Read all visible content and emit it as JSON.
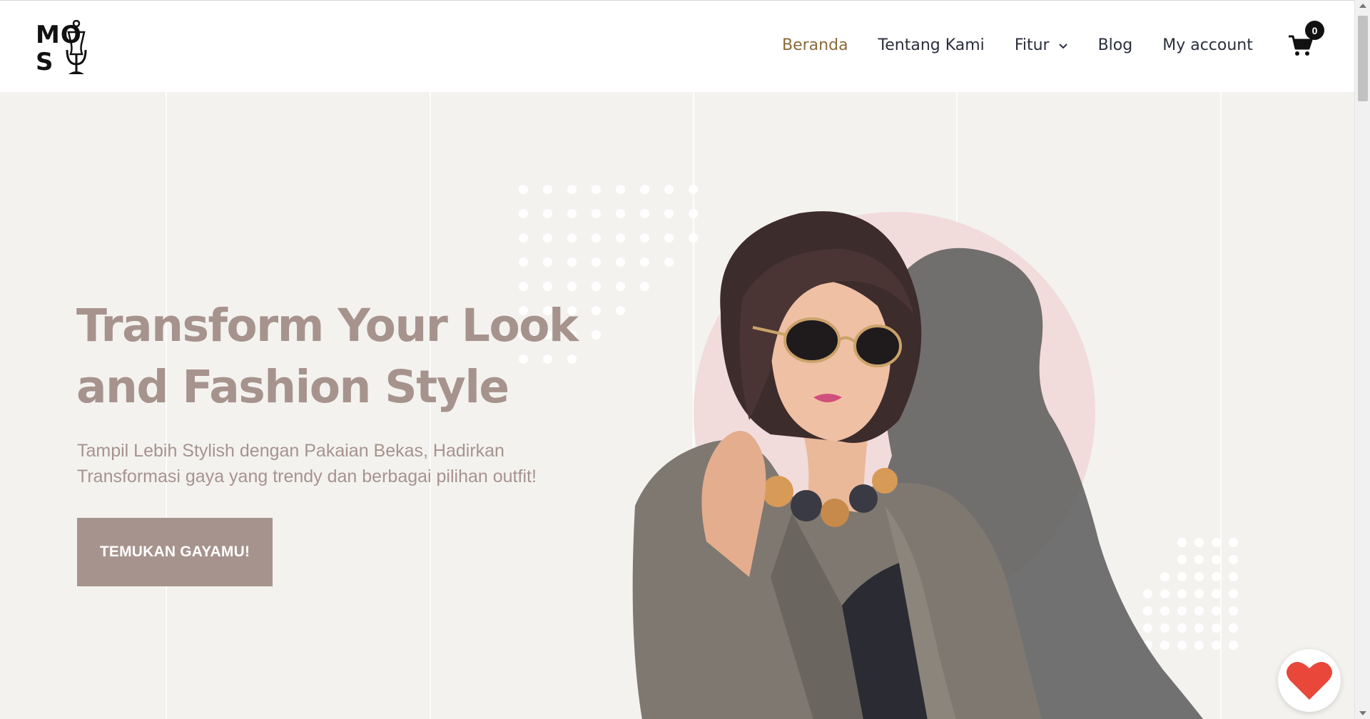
{
  "logo": {
    "left": "MO",
    "right": "S"
  },
  "nav": {
    "items": [
      {
        "label": "Beranda",
        "active": true
      },
      {
        "label": "Tentang Kami",
        "active": false
      },
      {
        "label": "Fitur",
        "active": false,
        "has_dropdown": true
      },
      {
        "label": "Blog",
        "active": false
      },
      {
        "label": "My account",
        "active": false
      }
    ],
    "cart_count": "0"
  },
  "hero": {
    "title_line1": "Transform Your Look",
    "title_line2": "and Fashion Style",
    "subtitle_line1": "Tampil Lebih Stylish dengan Pakaian Bekas, Hadirkan",
    "subtitle_line2": "Transformasi gaya yang trendy dan berbagai pilihan outfit!",
    "cta_label": "TEMUKAN GAYAMU!"
  },
  "colors": {
    "background": "#f3f2ef",
    "accent": "#a7938d",
    "nav_active": "#8a6a3c",
    "nav_text": "#2a2f3d",
    "circle": "#f1dcdb",
    "heart": "#e8473a"
  },
  "icons": [
    "mannequin-icon",
    "cart-icon",
    "chevron-down-icon",
    "heart-icon"
  ]
}
